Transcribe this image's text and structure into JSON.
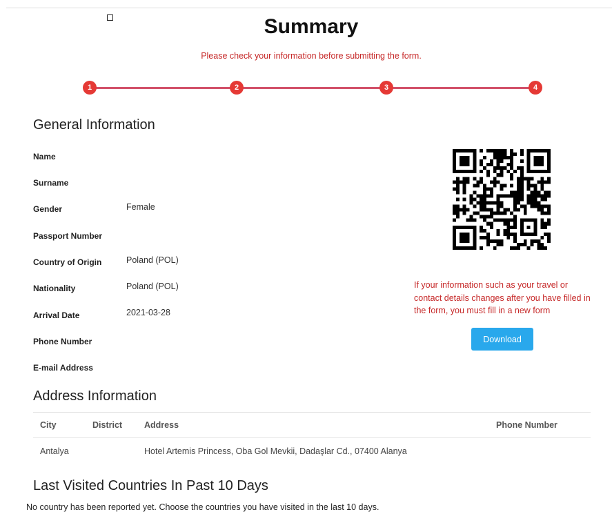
{
  "header": {
    "title": "Summary",
    "subtitle": "Please check your information before submitting the form."
  },
  "stepper": {
    "steps": [
      "1",
      "2",
      "3",
      "4"
    ],
    "accent_color": "#e53935",
    "line_color": "#d2526a"
  },
  "general": {
    "heading": "General Information",
    "fields": [
      {
        "label": "Name",
        "value": ""
      },
      {
        "label": "Surname",
        "value": ""
      },
      {
        "label": "Gender",
        "value": "Female"
      },
      {
        "label": "Passport Number",
        "value": ""
      },
      {
        "label": "Country of Origin",
        "value": "Poland (POL)"
      },
      {
        "label": "Nationality",
        "value": "Poland (POL)"
      },
      {
        "label": "Arrival Date",
        "value": "2021-03-28"
      },
      {
        "label": "Phone Number",
        "value": ""
      },
      {
        "label": "E-mail Address",
        "value": ""
      }
    ]
  },
  "side": {
    "qr_icon": "qr-code",
    "notice": "If your information such as your travel or contact details changes after you have filled in the form, you must fill in a new form",
    "download_label": "Download",
    "download_color": "#29a8ec"
  },
  "address": {
    "heading": "Address Information",
    "columns": [
      "City",
      "District",
      "Address",
      "Phone Number"
    ],
    "rows": [
      [
        "Antalya",
        "",
        "Hotel Artemis Princess, Oba Gol Mevkii, Dadaşlar Cd., 07400 Alanya",
        ""
      ]
    ]
  },
  "visited": {
    "heading": "Last Visited Countries In Past 10 Days",
    "empty_text": "No country has been reported yet. Choose the countries you have visited in the last 10 days."
  }
}
